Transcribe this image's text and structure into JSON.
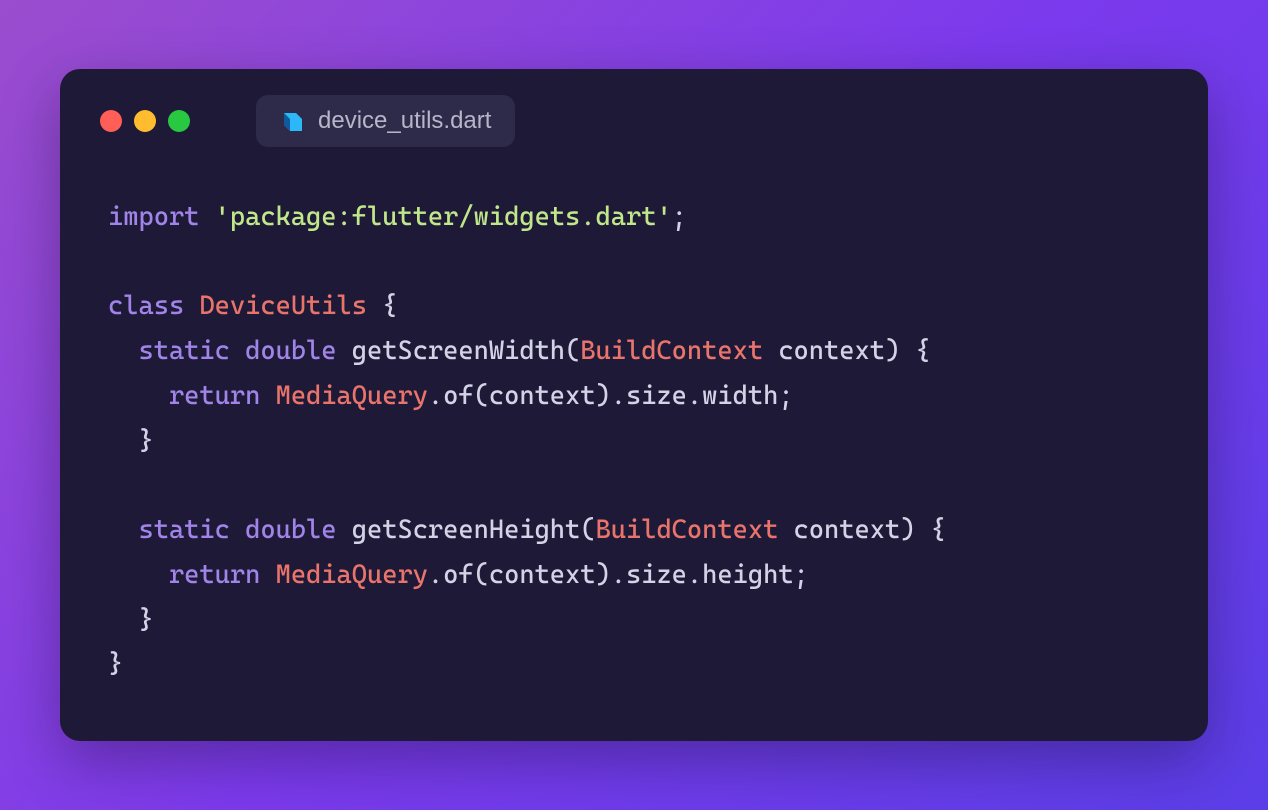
{
  "tab": {
    "filename": "device_utils.dart",
    "language": "dart"
  },
  "code": {
    "tokens": [
      [
        {
          "t": "import ",
          "c": "tok-keyword"
        },
        {
          "t": "'package:flutter/widgets.dart'",
          "c": "tok-string"
        },
        {
          "t": ";",
          "c": "tok-punct"
        }
      ],
      [],
      [
        {
          "t": "class ",
          "c": "tok-keyword"
        },
        {
          "t": "DeviceUtils",
          "c": "tok-class"
        },
        {
          "t": " {",
          "c": "tok-punct"
        }
      ],
      [
        {
          "t": "  ",
          "c": ""
        },
        {
          "t": "static ",
          "c": "tok-keyword"
        },
        {
          "t": "double ",
          "c": "tok-keyword"
        },
        {
          "t": "getScreenWidth(",
          "c": "tok-method"
        },
        {
          "t": "BuildContext",
          "c": "tok-type"
        },
        {
          "t": " context) {",
          "c": "tok-punct"
        }
      ],
      [
        {
          "t": "    ",
          "c": ""
        },
        {
          "t": "return ",
          "c": "tok-keyword"
        },
        {
          "t": "MediaQuery",
          "c": "tok-class"
        },
        {
          "t": ".of(context).size.width;",
          "c": "tok-punct"
        }
      ],
      [
        {
          "t": "  }",
          "c": "tok-punct"
        }
      ],
      [],
      [
        {
          "t": "  ",
          "c": ""
        },
        {
          "t": "static ",
          "c": "tok-keyword"
        },
        {
          "t": "double ",
          "c": "tok-keyword"
        },
        {
          "t": "getScreenHeight(",
          "c": "tok-method"
        },
        {
          "t": "BuildContext",
          "c": "tok-type"
        },
        {
          "t": " context) {",
          "c": "tok-punct"
        }
      ],
      [
        {
          "t": "    ",
          "c": ""
        },
        {
          "t": "return ",
          "c": "tok-keyword"
        },
        {
          "t": "MediaQuery",
          "c": "tok-class"
        },
        {
          "t": ".of(context).size.height;",
          "c": "tok-punct"
        }
      ],
      [
        {
          "t": "  }",
          "c": "tok-punct"
        }
      ],
      [
        {
          "t": "}",
          "c": "tok-punct"
        }
      ]
    ]
  }
}
